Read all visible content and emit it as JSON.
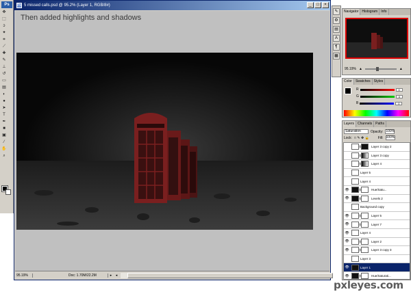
{
  "toolbox": {
    "logo": "Ps",
    "tools": [
      "move-icon",
      "marquee-icon",
      "lasso-icon",
      "magic-wand-icon",
      "crop-icon",
      "slice-icon",
      "healing-icon",
      "brush-icon",
      "stamp-icon",
      "history-brush-icon",
      "eraser-icon",
      "gradient-icon",
      "blur-icon",
      "dodge-icon",
      "path-select-icon",
      "type-icon",
      "pen-icon",
      "shape-icon",
      "notes-icon",
      "eyedropper-icon",
      "hand-icon",
      "zoom-icon"
    ],
    "foreground": "#000000",
    "background": "#ffffff"
  },
  "document": {
    "title": "5 missed calls.psd @ 95.2% (Layer 1, RGB/8#)",
    "caption": "Then added highlights and shadows",
    "status_zoom": "95.19%",
    "status_doc": "Doc: 1.70M/22.2M"
  },
  "navigator": {
    "tabs": [
      "Navigator",
      "Histogram",
      "Info"
    ],
    "zoom": "95.19%"
  },
  "color_panel": {
    "tabs": [
      "Color",
      "Swatches",
      "Styles"
    ],
    "channels": [
      {
        "label": "R",
        "value": "0",
        "color": "#cc0000"
      },
      {
        "label": "G",
        "value": "0",
        "color": "#009900"
      },
      {
        "label": "B",
        "value": "0",
        "color": "#0000cc"
      }
    ]
  },
  "layers_panel": {
    "tabs": [
      "Layers",
      "Channels",
      "Paths"
    ],
    "blend_mode": "Saturation",
    "opacity_label": "Opacity:",
    "opacity": "100%",
    "lock_label": "Lock:",
    "fill_label": "Fill:",
    "fill": "100%",
    "layers": [
      {
        "name": "Layer 3 copy 2",
        "eye": false,
        "thumb": "adj",
        "mask": "dark"
      },
      {
        "name": "Layer 3 copy",
        "eye": false,
        "thumb": "adj",
        "mask": "grad"
      },
      {
        "name": "Layer 4",
        "eye": false,
        "thumb": "adj",
        "mask": "grad"
      },
      {
        "name": "Layer 5",
        "eye": false,
        "thumb": "adj",
        "mask": ""
      },
      {
        "name": "Layer 4",
        "eye": false,
        "thumb": "adj",
        "mask": ""
      },
      {
        "name": "Hue/Satu...",
        "eye": true,
        "thumb": "dark",
        "mask": "white"
      },
      {
        "name": "Levels 2",
        "eye": true,
        "thumb": "dark",
        "mask": "white"
      },
      {
        "name": "Background copy",
        "eye": false,
        "thumb": "adj",
        "mask": ""
      },
      {
        "name": "Layer 5",
        "eye": true,
        "thumb": "adj",
        "mask": "white"
      },
      {
        "name": "Layer 7",
        "eye": true,
        "thumb": "adj",
        "mask": "white"
      },
      {
        "name": "Layer 4",
        "eye": true,
        "thumb": "adj",
        "mask": ""
      },
      {
        "name": "Layer 2",
        "eye": true,
        "thumb": "adj",
        "mask": "white"
      },
      {
        "name": "Layer 3 copy 3",
        "eye": true,
        "thumb": "adj",
        "mask": "white"
      },
      {
        "name": "Layer 3",
        "eye": false,
        "thumb": "adj",
        "mask": ""
      },
      {
        "name": "Layer 1",
        "eye": true,
        "thumb": "dark",
        "mask": "",
        "selected": true
      },
      {
        "name": "Hue/Saturati...",
        "eye": true,
        "thumb": "dark",
        "mask": "white"
      }
    ]
  },
  "watermark": "pxleyes.com"
}
